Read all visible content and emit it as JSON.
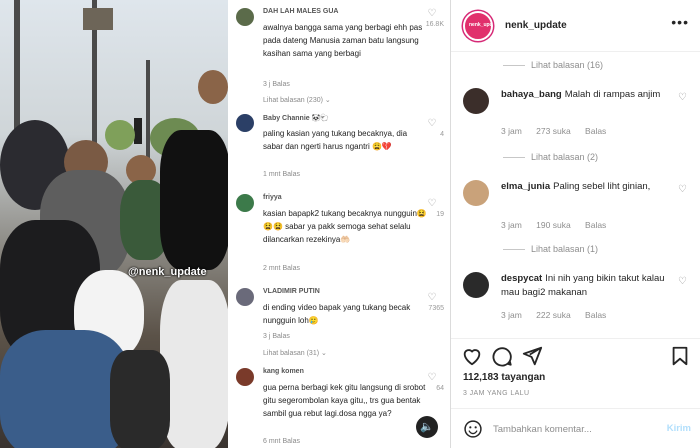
{
  "video": {
    "watermark": "@nenk_update",
    "comments": [
      {
        "user": "DAH LAH MALES GUA",
        "text": "awalnya bangga sama yang berbagi ehh pas pada dateng Manusia zaman batu langsung kasihan sama yang berbagi",
        "meta": "3 j   Balas",
        "replies": "Lihat balasan (230) ⌄",
        "likes": "16.8K",
        "avatar_color": "#5b6b4a"
      },
      {
        "user": "Baby Channie 🐼🐑",
        "text": "paling kasian yang tukang becaknya, dia sabar dan ngerti harus ngantri 😩💔",
        "meta": "1 mnt   Balas",
        "replies": "",
        "likes": "4",
        "avatar_color": "#2b3f66"
      },
      {
        "user": "friyya",
        "text": "kasian bapapk2 tukang becaknya nungguin😫😫😫 sabar ya pakk semoga sehat selalu dilancarkan rezekinya🤲🏻",
        "meta": "2 mnt   Balas",
        "replies": "",
        "likes": "19",
        "avatar_color": "#3c7a4a"
      },
      {
        "user": "VLADIMIR PUTIN",
        "text": "di ending video bapak yang tukang becak nungguin loh🥲",
        "meta": "3 j   Balas",
        "replies": "Lihat balasan (31) ⌄",
        "likes": "7365",
        "avatar_color": "#6a6a7a"
      },
      {
        "user": "kang komen",
        "text": "gua perna berbagi kek gitu langsung di srobot gitu segerombolan kaya gitu,, trs gua bentak sambil gua rebut lagi.dosa ngga ya?",
        "meta": "6 mnt   Balas",
        "replies": "",
        "likes": "64",
        "avatar_color": "#7a3a2a"
      }
    ],
    "sound_icon": "speaker-icon"
  },
  "header": {
    "username": "nenk_update",
    "avatar_text": "nenk_update",
    "more_icon": "more-dots-icon"
  },
  "thread": {
    "items": [
      {
        "kind": "replies",
        "label": "Lihat balasan (16)"
      },
      {
        "kind": "comment",
        "user": "bahaya_bang",
        "text": "Malah di rampas anjim",
        "time": "3 jam",
        "likes": "273 suka",
        "reply": "Balas",
        "avatar_color": "#3b2e2a"
      },
      {
        "kind": "replies",
        "label": "Lihat balasan (2)"
      },
      {
        "kind": "comment",
        "user": "elma_junia",
        "text": "Paling sebel liht ginian,",
        "time": "3 jam",
        "likes": "190 suka",
        "reply": "Balas",
        "avatar_color": "#c9a27a"
      },
      {
        "kind": "replies",
        "label": "Lihat balasan (1)"
      },
      {
        "kind": "comment",
        "user": "despycat",
        "text": "Ini nih yang bikin takut kalau mau bagi2 makanan",
        "time": "3 jam",
        "likes": "222 suka",
        "reply": "Balas",
        "avatar_color": "#2a2a2a"
      }
    ]
  },
  "actions": {
    "like_icon": "heart-icon",
    "comment_icon": "comment-icon",
    "share_icon": "send-icon",
    "save_icon": "bookmark-icon",
    "views": "112,183 tayangan",
    "time": "3 JAM YANG LALU"
  },
  "composer": {
    "placeholder": "Tambahkan komentar...",
    "post_label": "Kirim",
    "emoji_icon": "emoji-icon"
  },
  "colors": {
    "accent": "#e1306c",
    "post_disabled": "#b2dffc",
    "muted": "#8e8e8e"
  }
}
